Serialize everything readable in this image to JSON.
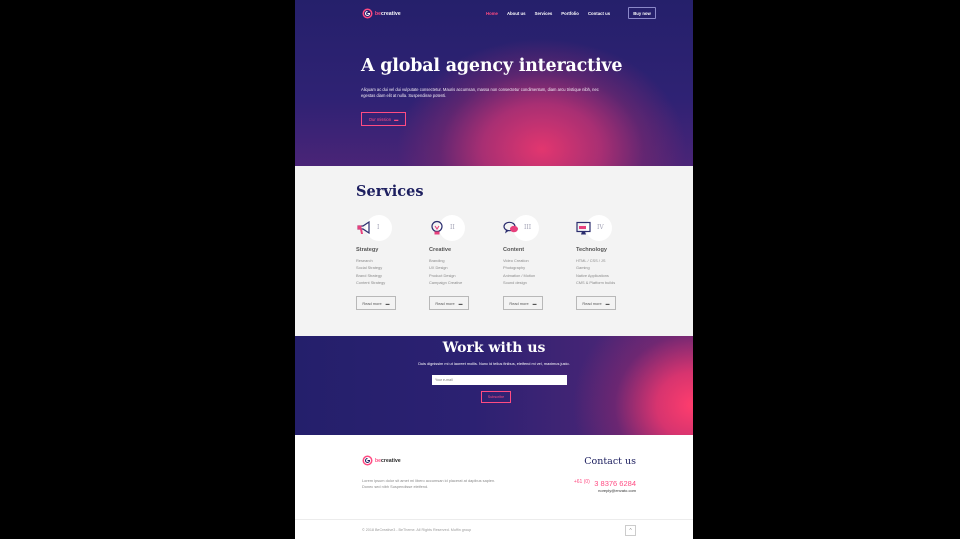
{
  "header": {
    "logo_be": "be",
    "logo_rest": "creative",
    "menu": [
      "Home",
      "About us",
      "Services",
      "Portfolio",
      "Contact us"
    ],
    "buy_label": "Buy now"
  },
  "hero": {
    "title": "A global agency interactive",
    "text": "Aliquam ac dui vel dui vulputate consectetur. Mauris accumsan, massa non consectetur condimentum, diam arcu tristique nibh, nec egestas diam elit at nulla. Suspendisse potenti.",
    "button_label": "Our mission"
  },
  "services": {
    "title": "Services",
    "more_label": "Read more",
    "items": [
      {
        "numeral": "I",
        "name": "Strategy",
        "icon": "megaphone-icon",
        "list": [
          "Research",
          "Social Strategy",
          "Brand Strategy",
          "Content Strategy"
        ]
      },
      {
        "numeral": "II",
        "name": "Creative",
        "icon": "lightbulb-icon",
        "list": [
          "Branding",
          "UX Design",
          "Product Design",
          "Campaign Creative"
        ]
      },
      {
        "numeral": "III",
        "name": "Content",
        "icon": "chat-bubbles-icon",
        "list": [
          "Video Creation",
          "Photography",
          "Animation / Motion",
          "Sound design"
        ]
      },
      {
        "numeral": "IV",
        "name": "Technology",
        "icon": "monitor-icon",
        "list": [
          "HTML / CSS / JS",
          "Gaming",
          "Native Applications",
          "CMS & Platform builds"
        ]
      }
    ]
  },
  "work": {
    "title": "Work with us",
    "text": "Duis dignissim mi ut laoreet mollis. Nunc id tellus finibus, eleifend mi vel, maximus justo.",
    "email_placeholder": "Your e-mail",
    "subscribe_label": "Subscribe"
  },
  "footer": {
    "text": "Lorem ipsum dolor sit amet mi libero accumsan id placerat at dapibus sapien. Donec sed nibh Suspendisse eleifend.",
    "contact_title": "Contact us",
    "phone_prefix": "+61 (0)",
    "phone_number": "3 8376 6284",
    "email": "noreply@envato.com",
    "copyright": "© 2018 BeCreative3 - BeTheme. All Rights Reserved. Muffin group",
    "to_top": "^"
  },
  "colors": {
    "accent": "#ff4b82",
    "navy": "#1e2060"
  }
}
